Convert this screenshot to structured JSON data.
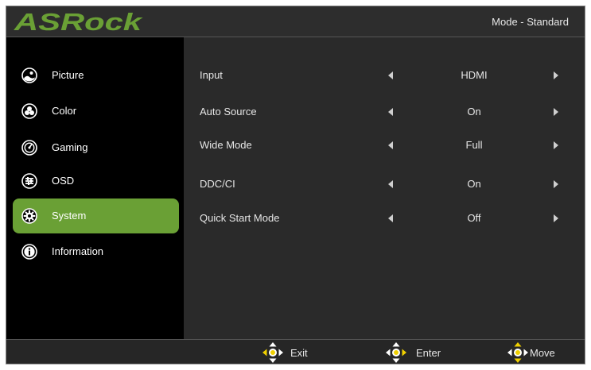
{
  "header": {
    "brand": "ASRock",
    "mode": "Mode - Standard"
  },
  "sidebar": {
    "items": [
      {
        "label": "Picture",
        "icon": "picture-icon"
      },
      {
        "label": "Color",
        "icon": "color-icon"
      },
      {
        "label": "Gaming",
        "icon": "gaming-icon"
      },
      {
        "label": "OSD",
        "icon": "osd-icon"
      },
      {
        "label": "System",
        "icon": "system-gear-icon",
        "active": true
      },
      {
        "label": "Information",
        "icon": "information-icon"
      }
    ]
  },
  "settings": [
    {
      "label": "Input",
      "value": "HDMI"
    },
    {
      "label": "Auto Source",
      "value": "On"
    },
    {
      "label": "Wide Mode",
      "value": "Full"
    },
    {
      "label": "DDC/CI",
      "value": "On"
    },
    {
      "label": "Quick Start Mode",
      "value": "Off"
    }
  ],
  "footer": {
    "exit": "Exit",
    "enter": "Enter",
    "move": "Move"
  },
  "colors": {
    "accent": "#6aa035",
    "joystick_highlight": "#f0d000"
  }
}
